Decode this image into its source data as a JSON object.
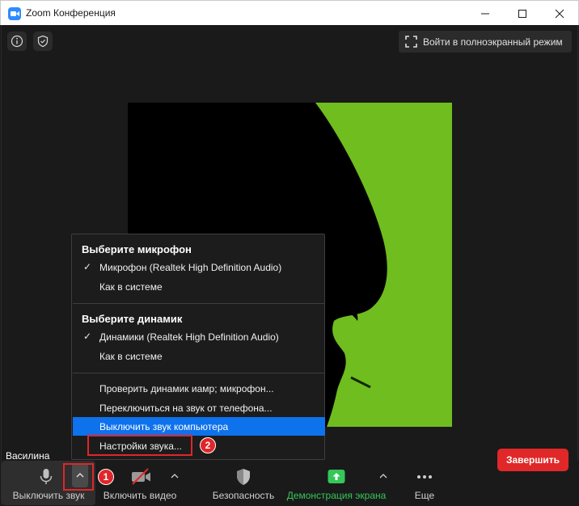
{
  "window": {
    "title": "Zoom Конференция",
    "minimize": "—",
    "maximize": "☐",
    "close": "✕"
  },
  "top": {
    "fullscreen_label": "Войти в полноэкранный режим"
  },
  "participant": {
    "name": "Василина"
  },
  "menu": {
    "mic_header": "Выберите микрофон",
    "mic_items": [
      {
        "label": "Микрофон (Realtek High Definition Audio)",
        "checked": true
      },
      {
        "label": "Как в системе",
        "checked": false
      }
    ],
    "speaker_header": "Выберите динамик",
    "speaker_items": [
      {
        "label": "Динамики (Realtek High Definition Audio)",
        "checked": true
      },
      {
        "label": "Как в системе",
        "checked": false
      }
    ],
    "actions": [
      {
        "label": "Проверить динамик иамр; микрофон..."
      },
      {
        "label": "Переключиться на звук от телефона..."
      },
      {
        "label": "Выключить звук компьютера"
      },
      {
        "label": "Настройки звука..."
      }
    ],
    "check_glyph": "✓"
  },
  "toolbar": {
    "mute_label": "Выключить звук",
    "video_label": "Включить видео",
    "security_label": "Безопасность",
    "share_label": "Демонстрация экрана",
    "more_label": "Еще",
    "end_label": "Завершить",
    "caret": "^"
  },
  "annotations": {
    "badge1": "1",
    "badge2": "2"
  },
  "colors": {
    "accent_blue": "#0e72ed",
    "end_red": "#e02828",
    "share_green": "#34c759",
    "annotation_red": "#e0262a",
    "video_green": "#6fbd1f"
  }
}
